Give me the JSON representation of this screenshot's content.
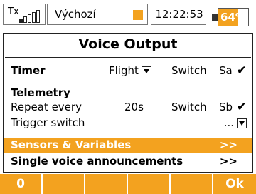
{
  "statusbar": {
    "tx_label": "Tx",
    "tx_sub": "",
    "profile_name": "Výchozí",
    "clock": "12:22:53",
    "battery_percent_text": "64%",
    "battery_level": 0.64,
    "accent_color": "#f3a21f"
  },
  "screen": {
    "title": "Voice Output",
    "timer": {
      "label": "Timer",
      "mode": "Flight",
      "switch_label": "Switch",
      "switch_value": "Sa",
      "check": "✔"
    },
    "telemetry": {
      "heading": "Telemetry",
      "repeat_label": "Repeat every",
      "repeat_value": "20s",
      "switch_label": "Switch",
      "switch_value": "Sb",
      "check": "✔",
      "trigger_label": "Trigger switch",
      "trigger_value": "..."
    },
    "sensors_label": "Sensors & Variables",
    "sensors_arrow": ">>",
    "single_label": "Single voice announcements",
    "single_arrow": ">>"
  },
  "softkeys": [
    "0",
    "",
    "",
    "",
    "",
    "Ok"
  ]
}
